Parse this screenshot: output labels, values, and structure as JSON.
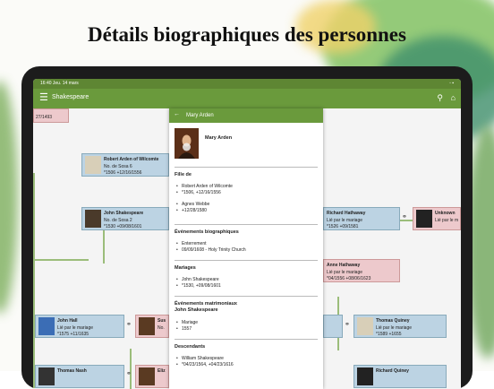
{
  "headline": "Détails biographiques des personnes",
  "status": {
    "time": "16:40",
    "date": "Jeu. 14 mars",
    "battery": "◦ ▪"
  },
  "appbar": {
    "title": "Shakespeare"
  },
  "panel": {
    "title": "Mary Arden",
    "name": "Mary Arden",
    "sections": {
      "daughter_of": "Fille de",
      "parent1": "Robert Arden of Wilcomte",
      "parent1_dates": "*1506, +12/16/1556",
      "parent2": "Agnes Webbe",
      "parent2_dates": "+12/28/1580",
      "bio_events": "Événements biographiques",
      "burial": "Enterrement",
      "burial_detail": "09/09/1608 - Holy Trinity Church",
      "marriages": "Mariages",
      "spouse": "John Shakespeare",
      "spouse_dates": "*1530, +09/08/1601",
      "mat_events": "Événements matrimoniaux",
      "mat_with": "John Shakespeare",
      "marriage_event": "Mariage",
      "marriage_year": "1557",
      "descendants": "Descendants",
      "child": "William Shakespeare",
      "child_dates": "*04/23/1564, +04/23/1616"
    }
  },
  "tree": {
    "top_left_date": "27/1493",
    "robert": {
      "name": "Robert Arden of Wilcomte",
      "l1": "No. de Sosa 6",
      "l2": "*1506   +12/16/1556"
    },
    "john": {
      "name": "John Shakespeare",
      "l1": "No. de Sosa 2",
      "l2": "*1530   +09/08/1601"
    },
    "richard_h": {
      "name": "Richard Hathaway",
      "l1": "Lié par le mariage",
      "l2": "*1526   +09/1581"
    },
    "unknown": {
      "name": "Unknown",
      "l1": "Lié par le m"
    },
    "anne": {
      "name": "Anne Hathaway",
      "l1": "Lié par le mariage",
      "l2": "*04/1556   +08/06/1623"
    },
    "john_hall": {
      "name": "John Hall",
      "l1": "Lié par le mariage",
      "l2": "*1575   +11/1635"
    },
    "sus": {
      "name": "Sus",
      "l1": "No."
    },
    "thomas_q": {
      "name": "Thomas Quiney",
      "l1": "Lié par le mariage",
      "l2": "*1589   +1655"
    },
    "thomas_n": {
      "name": "Thomas Nash"
    },
    "eliz": {
      "name": "Eliz"
    },
    "richard_q": {
      "name": "Richard Quiney"
    }
  }
}
